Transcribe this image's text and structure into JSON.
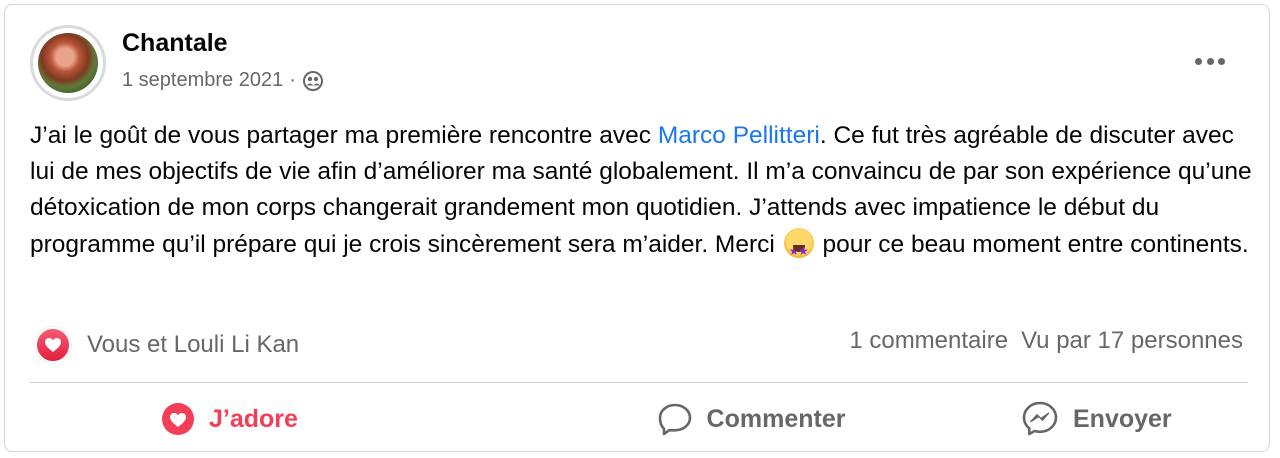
{
  "post": {
    "author": "Chantale",
    "date": "1 septembre 2021",
    "separator": "·",
    "audience_icon": "friends-icon",
    "text_1": "J’ai le goût de vous partager ma première rencontre avec ",
    "mention": "Marco Pellitteri",
    "text_2": ". Ce fut très agréable de discuter avec lui de mes objectifs de vie afin d’améliorer ma santé globalement. Il m’a convaincu de par son expérience qu’une détoxication de mon corps changerait grandement mon quotidien. J’attends avec impatience le début du programme qu’il prépare qui je crois sincèrement sera m’aider. Merci ",
    "emoji": "star-struck-emoji",
    "text_3": " pour ce beau moment entre continents."
  },
  "reactions": {
    "summary": "Vous et Louli Li Kan",
    "icon": "love-reaction-icon"
  },
  "stats": {
    "comments": "1 commentaire",
    "views": "Vu par 17 personnes"
  },
  "actions": {
    "love_label": "J’adore",
    "comment_label": "Commenter",
    "send_label": "Envoyer"
  },
  "colors": {
    "accent": "#1877f2",
    "love": "#f33e58",
    "secondary_text": "#65676b"
  }
}
